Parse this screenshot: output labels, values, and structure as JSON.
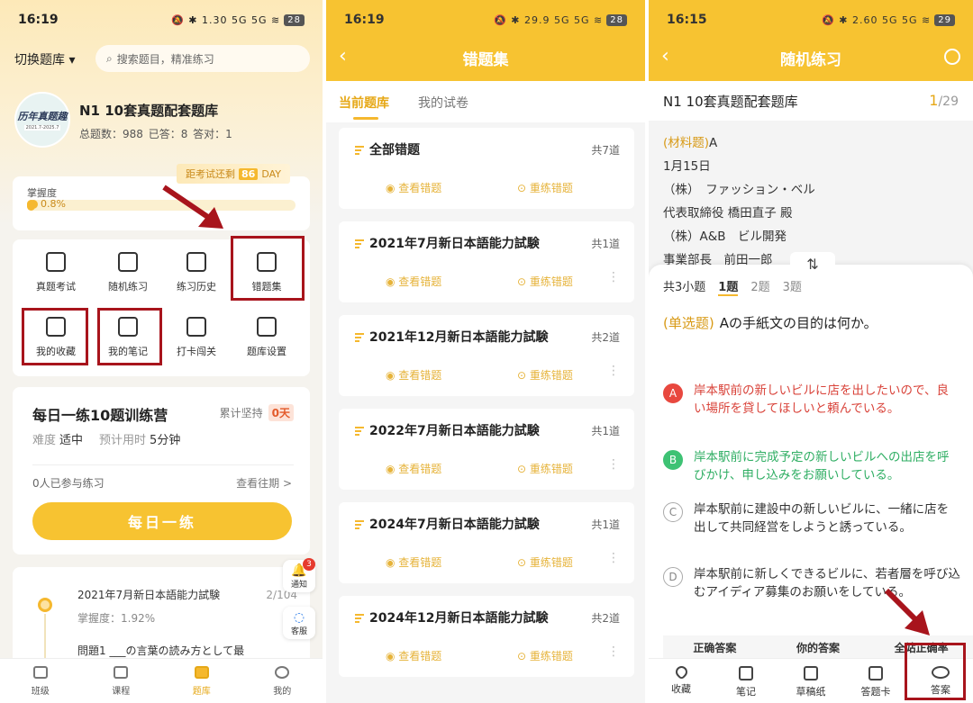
{
  "panel1": {
    "status": {
      "time": "16:19",
      "icons": "🔕 ✱ 1.30 5G 5G ≋",
      "battery": "28"
    },
    "switch_label": "切换题库",
    "search_placeholder": "搜索题目，精准练习",
    "bank": {
      "logo_line1": "历年真题趣",
      "logo_line2": "2021.7-2025.7",
      "title": "N1 10套真题配套题库",
      "stats": "总题数：988  已答：8  答对：1"
    },
    "countdown": {
      "label": "距考试还剩",
      "days": "86",
      "unit": "DAY"
    },
    "mastery": {
      "label": "掌握度",
      "percent_text": "0.8%",
      "percent": 0.008
    },
    "grid": [
      {
        "label": "真题考试",
        "icon": "clipboard-icon"
      },
      {
        "label": "随机练习",
        "icon": "chart-icon"
      },
      {
        "label": "练习历史",
        "icon": "history-icon"
      },
      {
        "label": "错题集",
        "icon": "book-icon"
      },
      {
        "label": "我的收藏",
        "icon": "star-icon"
      },
      {
        "label": "我的笔记",
        "icon": "pencil-icon"
      },
      {
        "label": "打卡闯关",
        "icon": "calendar-icon"
      },
      {
        "label": "题库设置",
        "icon": "gear-icon"
      }
    ],
    "daily": {
      "title": "每日一练10题训练营",
      "streak_label": "累计坚持",
      "streak_value": "0天",
      "difficulty_label": "难度",
      "difficulty_value": "适中",
      "time_label": "预计用时",
      "time_value": "5分钟",
      "participants": "0人已参与练习",
      "history_link": "查看往期 >",
      "button": "每日一练"
    },
    "float": [
      {
        "label": "通知",
        "badge": "3"
      },
      {
        "label": "客服"
      }
    ],
    "record": {
      "name": "2021年7月新日本語能力試験",
      "progress": "2/104",
      "mastery": "掌握度：1.92%",
      "question": "問題1 ___の言葉の読み方として最"
    },
    "tabs": [
      {
        "label": "班级"
      },
      {
        "label": "课程"
      },
      {
        "label": "题库"
      },
      {
        "label": "我的"
      }
    ]
  },
  "panel2": {
    "status": {
      "time": "16:19",
      "icons": "🔕 ✱ 29.9 5G 5G ≋",
      "battery": "28"
    },
    "title": "错题集",
    "tabs": [
      "当前题库",
      "我的试卷"
    ],
    "cards": [
      {
        "title": "全部错题",
        "count": "共7道",
        "view": "查看错题",
        "redo": "重练错题"
      },
      {
        "title": "2021年7月新日本語能力試験",
        "count": "共1道",
        "view": "查看错题",
        "redo": "重练错题"
      },
      {
        "title": "2021年12月新日本語能力試験",
        "count": "共2道",
        "view": "查看错题",
        "redo": "重练错题"
      },
      {
        "title": "2022年7月新日本語能力試験",
        "count": "共1道",
        "view": "查看错题",
        "redo": "重练错题"
      },
      {
        "title": "2024年7月新日本語能力試験",
        "count": "共1道",
        "view": "查看错题",
        "redo": "重练错题"
      },
      {
        "title": "2024年12月新日本語能力試験",
        "count": "共2道",
        "view": "查看错题",
        "redo": "重练错题"
      }
    ]
  },
  "panel3": {
    "status": {
      "time": "16:15",
      "icons": "🔕 ✱ 2.60 5G 5G ≋",
      "battery": "29"
    },
    "title": "随机练习",
    "bank_title": "N1 10套真题配套题库",
    "page_current": "1",
    "page_total": "/29",
    "passage": {
      "tag": "(材料题)",
      "tag_suffix": "A",
      "lines": [
        "1月15日",
        "（株）　ファッション・ベル",
        "代表取締役 橋田直子 殿",
        "（株）A&B　ビル開発",
        "事業部長　前田一郎"
      ]
    },
    "qtabs": {
      "total": "共3小题",
      "items": [
        "1题",
        "2题",
        "3题"
      ]
    },
    "question": {
      "tag": "(单选题)",
      "text": "Aの手紙文の目的は何か。"
    },
    "options": [
      {
        "key": "A",
        "text": "岸本駅前の新しいビルに店を出したいので、良い場所を貸してほしいと頼んでいる。",
        "state": "wrong"
      },
      {
        "key": "B",
        "text": "岸本駅前に完成予定の新しいビルへの出店を呼びかけ、申し込みをお願いしている。",
        "state": "right"
      },
      {
        "key": "C",
        "text": "岸本駅前に建設中の新しいビルに、一緒に店を出して共同経営をしようと誘っている。",
        "state": "none"
      },
      {
        "key": "D",
        "text": "岸本駅前に新しくできるビルに、若者層を呼び込むアイディア募集のお願いをしている。",
        "state": "none"
      }
    ],
    "answer_strip": [
      "正确答案",
      "你的答案",
      "全站正确率"
    ],
    "bottom": [
      {
        "label": "收藏"
      },
      {
        "label": "笔记"
      },
      {
        "label": "草稿纸"
      },
      {
        "label": "答题卡"
      },
      {
        "label": "答案"
      }
    ]
  },
  "colors": {
    "accent": "#f7c331",
    "highlight_box": "#a8141c",
    "wrong": "#e8483f",
    "right": "#3ec274"
  }
}
